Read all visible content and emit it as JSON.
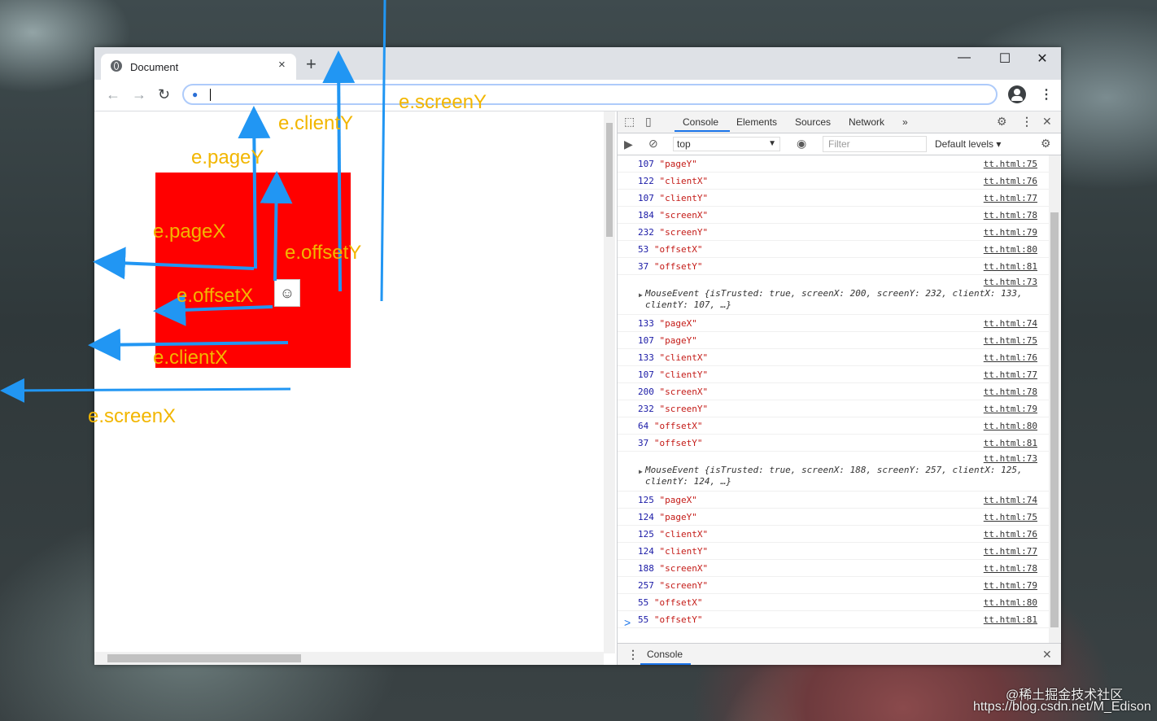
{
  "browser": {
    "tab_title": "Document",
    "tab_close": "×",
    "new_tab": "+",
    "window_minimize": "—",
    "window_maximize": "☐",
    "window_close": "✕"
  },
  "devtools": {
    "tabs": [
      "Console",
      "Elements",
      "Sources",
      "Network"
    ],
    "more": "»",
    "context": "top",
    "filter_placeholder": "Filter",
    "levels": "Default levels",
    "drawer_tab": "Console",
    "prompt": ">",
    "log_rows": [
      {
        "n": "107",
        "s": "\"pageY\"",
        "src": "tt.html:75"
      },
      {
        "n": "122",
        "s": "\"clientX\"",
        "src": "tt.html:76"
      },
      {
        "n": "107",
        "s": "\"clientY\"",
        "src": "tt.html:77"
      },
      {
        "n": "184",
        "s": "\"screenX\"",
        "src": "tt.html:78"
      },
      {
        "n": "232",
        "s": "\"screenY\"",
        "src": "tt.html:79"
      },
      {
        "n": "53",
        "s": "\"offsetX\"",
        "src": "tt.html:80"
      },
      {
        "n": "37",
        "s": "\"offsetY\"",
        "src": "tt.html:81"
      },
      {
        "event": true,
        "src": "tt.html:73",
        "line1": "MouseEvent {isTrusted: true, screenX: 200, screenY: 232, clientX: 133,",
        "line2": "clientY: 107, …}"
      },
      {
        "n": "133",
        "s": "\"pageX\"",
        "src": "tt.html:74"
      },
      {
        "n": "107",
        "s": "\"pageY\"",
        "src": "tt.html:75"
      },
      {
        "n": "133",
        "s": "\"clientX\"",
        "src": "tt.html:76"
      },
      {
        "n": "107",
        "s": "\"clientY\"",
        "src": "tt.html:77"
      },
      {
        "n": "200",
        "s": "\"screenX\"",
        "src": "tt.html:78"
      },
      {
        "n": "232",
        "s": "\"screenY\"",
        "src": "tt.html:79"
      },
      {
        "n": "64",
        "s": "\"offsetX\"",
        "src": "tt.html:80"
      },
      {
        "n": "37",
        "s": "\"offsetY\"",
        "src": "tt.html:81"
      },
      {
        "event": true,
        "src": "tt.html:73",
        "line1": "MouseEvent {isTrusted: true, screenX: 188, screenY: 257, clientX: 125,",
        "line2": "clientY: 124, …}"
      },
      {
        "n": "125",
        "s": "\"pageX\"",
        "src": "tt.html:74"
      },
      {
        "n": "124",
        "s": "\"pageY\"",
        "src": "tt.html:75"
      },
      {
        "n": "125",
        "s": "\"clientX\"",
        "src": "tt.html:76"
      },
      {
        "n": "124",
        "s": "\"clientY\"",
        "src": "tt.html:77"
      },
      {
        "n": "188",
        "s": "\"screenX\"",
        "src": "tt.html:78"
      },
      {
        "n": "257",
        "s": "\"screenY\"",
        "src": "tt.html:79"
      },
      {
        "n": "55",
        "s": "\"offsetX\"",
        "src": "tt.html:80"
      },
      {
        "n": "55",
        "s": "\"offsetY\"",
        "src": "tt.html:81"
      }
    ]
  },
  "annotations": {
    "screenY": "e.screenY",
    "clientY": "e.clientY",
    "pageY": "e.pageY",
    "pageX": "e.pageX",
    "offsetY": "e.offsetY",
    "offsetX": "e.offsetX",
    "clientX": "e.clientX",
    "screenX": "e.screenX",
    "arrow_color": "#2196f3",
    "label_color": "#f2b600"
  },
  "watermark": {
    "line1": "@稀土掘金技术社区",
    "line2": "https://blog.csdn.net/M_Edison"
  }
}
